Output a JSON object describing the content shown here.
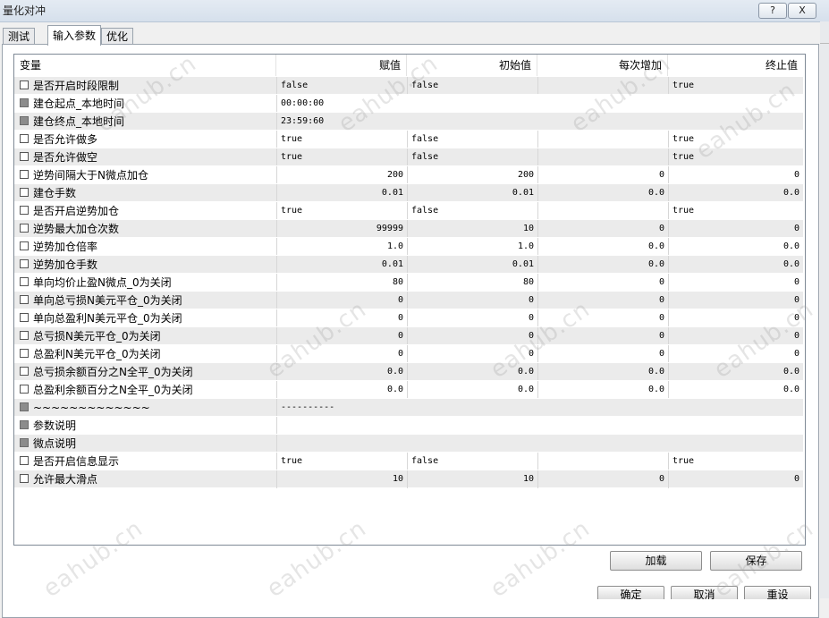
{
  "window": {
    "title": "量化对冲",
    "help_label": "?",
    "close_label": "X"
  },
  "tabs": [
    {
      "label": "测试"
    },
    {
      "label": "输入参数"
    },
    {
      "label": "优化"
    }
  ],
  "grid": {
    "columns": [
      "变量",
      "赋值",
      "初始值",
      "每次增加",
      "终止值"
    ],
    "rows": [
      {
        "name": "是否开启时段限制",
        "value": "false",
        "start": "false",
        "step": "",
        "stop": "true",
        "align": "l",
        "check": "empty"
      },
      {
        "name": "建仓起点_本地时间",
        "value": "00:00:00",
        "start": "",
        "step": "",
        "stop": "",
        "align": "l",
        "check": "disabled"
      },
      {
        "name": "建仓终点_本地时间",
        "value": "23:59:60",
        "start": "",
        "step": "",
        "stop": "",
        "align": "l",
        "check": "disabled"
      },
      {
        "name": "是否允许做多",
        "value": "true",
        "start": "false",
        "step": "",
        "stop": "true",
        "align": "l",
        "check": "empty"
      },
      {
        "name": "是否允许做空",
        "value": "true",
        "start": "false",
        "step": "",
        "stop": "true",
        "align": "l",
        "check": "empty"
      },
      {
        "name": "逆势间隔大于N微点加仓",
        "value": "200",
        "start": "200",
        "step": "0",
        "stop": "0",
        "align": "r",
        "check": "empty"
      },
      {
        "name": "建仓手数",
        "value": "0.01",
        "start": "0.01",
        "step": "0.0",
        "stop": "0.0",
        "align": "r",
        "check": "empty"
      },
      {
        "name": "是否开启逆势加仓",
        "value": "true",
        "start": "false",
        "step": "",
        "stop": "true",
        "align": "l",
        "check": "empty"
      },
      {
        "name": "逆势最大加仓次数",
        "value": "99999",
        "start": "10",
        "step": "0",
        "stop": "0",
        "align": "r",
        "check": "empty"
      },
      {
        "name": "逆势加仓倍率",
        "value": "1.0",
        "start": "1.0",
        "step": "0.0",
        "stop": "0.0",
        "align": "r",
        "check": "empty"
      },
      {
        "name": "逆势加仓手数",
        "value": "0.01",
        "start": "0.01",
        "step": "0.0",
        "stop": "0.0",
        "align": "r",
        "check": "empty"
      },
      {
        "name": "单向均价止盈N微点_0为关闭",
        "value": "80",
        "start": "80",
        "step": "0",
        "stop": "0",
        "align": "r",
        "check": "empty"
      },
      {
        "name": "单向总亏损N美元平仓_0为关闭",
        "value": "0",
        "start": "0",
        "step": "0",
        "stop": "0",
        "align": "r",
        "check": "empty"
      },
      {
        "name": "单向总盈利N美元平仓_0为关闭",
        "value": "0",
        "start": "0",
        "step": "0",
        "stop": "0",
        "align": "r",
        "check": "empty"
      },
      {
        "name": "总亏损N美元平仓_0为关闭",
        "value": "0",
        "start": "0",
        "step": "0",
        "stop": "0",
        "align": "r",
        "check": "empty"
      },
      {
        "name": "总盈利N美元平仓_0为关闭",
        "value": "0",
        "start": "0",
        "step": "0",
        "stop": "0",
        "align": "r",
        "check": "empty"
      },
      {
        "name": "总亏损余额百分之N全平_0为关闭",
        "value": "0.0",
        "start": "0.0",
        "step": "0.0",
        "stop": "0.0",
        "align": "r",
        "check": "empty"
      },
      {
        "name": "总盈利余额百分之N全平_0为关闭",
        "value": "0.0",
        "start": "0.0",
        "step": "0.0",
        "stop": "0.0",
        "align": "r",
        "check": "empty"
      },
      {
        "name": "~~~~~~~~~~~~~",
        "value": "----------",
        "start": "",
        "step": "",
        "stop": "",
        "align": "l",
        "check": "disabled"
      },
      {
        "name": "参数说明",
        "value": "",
        "start": "",
        "step": "",
        "stop": "",
        "align": "l",
        "check": "disabled"
      },
      {
        "name": "微点说明",
        "value": "",
        "start": "",
        "step": "",
        "stop": "",
        "align": "l",
        "check": "disabled"
      },
      {
        "name": "是否开启信息显示",
        "value": "true",
        "start": "false",
        "step": "",
        "stop": "true",
        "align": "l",
        "check": "empty"
      },
      {
        "name": "允许最大滑点",
        "value": "10",
        "start": "10",
        "step": "0",
        "stop": "0",
        "align": "r",
        "check": "empty"
      }
    ]
  },
  "buttons": {
    "load": "加载",
    "save": "保存",
    "ok": "确定",
    "cancel": "取消",
    "reset": "重设"
  },
  "watermark": "eahub.cn"
}
